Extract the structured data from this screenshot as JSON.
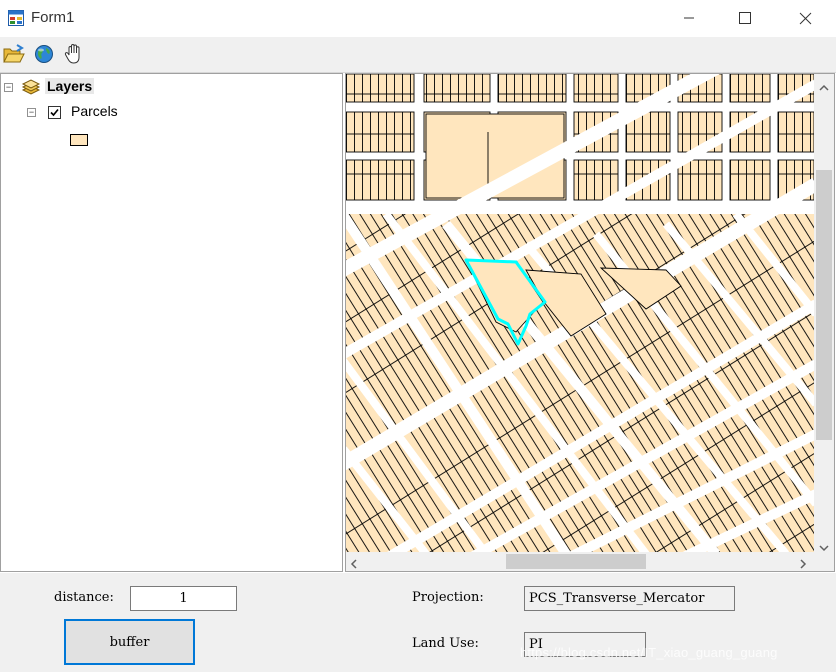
{
  "window": {
    "title": "Form1"
  },
  "toolbar": {
    "open_icon": "folder-open-icon",
    "globe_icon": "globe-icon",
    "pan_icon": "hand-pan-icon"
  },
  "toc": {
    "root_label": "Layers",
    "layer_label": "Parcels",
    "layer_checked": true
  },
  "map": {
    "fill_color": "#FFE6BE",
    "road_color": "#FFFFFF",
    "outline_color": "#000000",
    "selection_color": "#00FFFF"
  },
  "form": {
    "distance_label": "distance:",
    "distance_value": "1",
    "buffer_label": "buffer",
    "projection_label": "Projection:",
    "projection_value": "PCS_Transverse_Mercator",
    "landuse_label": "Land Use:",
    "landuse_value": "PI"
  },
  "watermark": "https://blog.csdn.net/IT_xiao_guang_guang"
}
